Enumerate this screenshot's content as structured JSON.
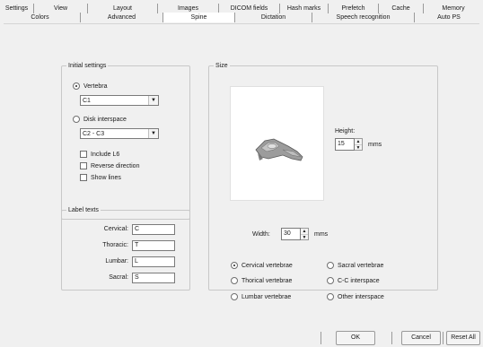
{
  "tabs_row1": [
    "Settings",
    "View",
    "Layout",
    "Images",
    "DICOM fields",
    "Hash marks",
    "Prefetch",
    "Cache",
    "Memory"
  ],
  "tabs_row2": [
    "Colors",
    "Advanced",
    "Spine",
    "Dictation",
    "Speech recognition",
    "Auto PS"
  ],
  "active_tab": "Spine",
  "initial_settings": {
    "legend": "Initial settings",
    "vertebra_label": "Vertebra",
    "vertebra_value": "C1",
    "disk_label": "Disk interspace",
    "disk_value": "C2 - C3",
    "include_l6": "Include L6",
    "reverse_direction": "Reverse direction",
    "show_lines": "Show lines"
  },
  "label_texts": {
    "legend": "Label texts",
    "cervical_label": "Cervical:",
    "cervical_value": "C",
    "thoracic_label": "Thoracic:",
    "thoracic_value": "T",
    "lumbar_label": "Lumbar:",
    "lumbar_value": "L",
    "sacral_label": "Sacral:",
    "sacral_value": "S"
  },
  "size": {
    "legend": "Size",
    "height_label": "Height:",
    "height_value": "15",
    "height_unit": "mms",
    "width_label": "Width:",
    "width_value": "30",
    "width_unit": "mms",
    "options": {
      "cervical_vertebrae": "Cervical vertebrae",
      "sacral_vertebrae": "Sacral vertebrae",
      "thoracic_vertebrae": "Thorical vertebrae",
      "cc_interspace": "C-C interspace",
      "lumbar_vertebrae": "Lumbar vertebrae",
      "other_interspace": "Other interspace"
    }
  },
  "buttons": {
    "ok": "OK",
    "cancel": "Cancel",
    "reset_all": "Reset All"
  }
}
